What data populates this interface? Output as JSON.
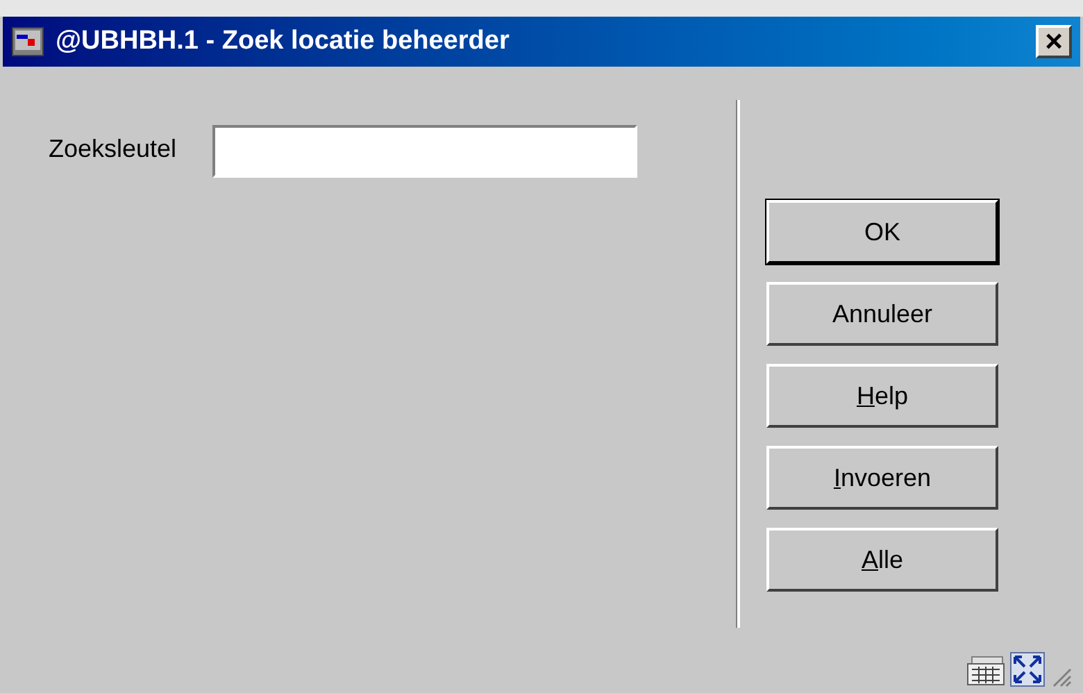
{
  "window": {
    "title": "@UBHBH.1 - Zoek locatie beheerder",
    "close": "×"
  },
  "field": {
    "label": "Zoeksleutel"
  },
  "buttons": [
    {
      "rest": "OK",
      "default": true
    },
    {
      "rest": "Annuleer",
      "default": false
    },
    {
      "key": "H",
      "rest": "elp",
      "default": false
    },
    {
      "key": "I",
      "rest": "nvoeren",
      "default": false
    },
    {
      "key": "A",
      "rest": "lle",
      "default": false
    }
  ]
}
